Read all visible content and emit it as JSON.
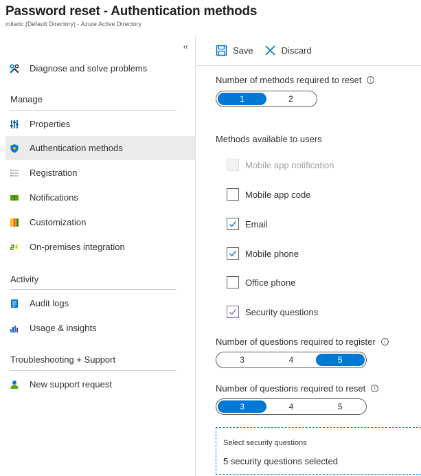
{
  "header": {
    "title": "Password reset - Authentication methods",
    "subtitle": "mitaric (Default Directory) - Azure Active Directory"
  },
  "nav": {
    "collapse_glyph": "«",
    "diagnose": {
      "label": "Diagnose and solve problems",
      "icon": "wrench-icon"
    },
    "sections": {
      "manage": "Manage",
      "activity": "Activity",
      "troubleshooting": "Troubleshooting + Support"
    },
    "manage_items": [
      {
        "label": "Properties",
        "icon": "sliders-icon"
      },
      {
        "label": "Authentication methods",
        "icon": "shield-icon",
        "active": true
      },
      {
        "label": "Registration",
        "icon": "list-icon"
      },
      {
        "label": "Notifications",
        "icon": "notification-icon"
      },
      {
        "label": "Customization",
        "icon": "customization-icon"
      },
      {
        "label": "On-premises integration",
        "icon": "integration-icon"
      }
    ],
    "activity_items": [
      {
        "label": "Audit logs",
        "icon": "audit-log-icon"
      },
      {
        "label": "Usage & insights",
        "icon": "chart-icon"
      }
    ],
    "support_items": [
      {
        "label": "New support request",
        "icon": "support-person-icon"
      }
    ]
  },
  "toolbar": {
    "save_label": "Save",
    "discard_label": "Discard"
  },
  "methods_required": {
    "label": "Number of methods required to reset",
    "options": [
      "1",
      "2"
    ],
    "selected": "1"
  },
  "methods_available": {
    "label": "Methods available to users",
    "items": [
      {
        "label": "Mobile app notification",
        "checked": false,
        "disabled": true
      },
      {
        "label": "Mobile app code",
        "checked": false,
        "disabled": false
      },
      {
        "label": "Email",
        "checked": true,
        "disabled": false
      },
      {
        "label": "Mobile phone",
        "checked": true,
        "disabled": false
      },
      {
        "label": "Office phone",
        "checked": false,
        "disabled": false
      },
      {
        "label": "Security questions",
        "checked": true,
        "disabled": false
      }
    ]
  },
  "questions_register": {
    "label": "Number of questions required to register",
    "options": [
      "3",
      "4",
      "5"
    ],
    "selected": "5"
  },
  "questions_reset": {
    "label": "Number of questions required to reset",
    "options": [
      "3",
      "4",
      "5"
    ],
    "selected": "3"
  },
  "select_questions": {
    "title": "Select security questions",
    "value": "5 security questions selected"
  },
  "colors": {
    "accent": "#0078d4",
    "check_blue": "#0078d4",
    "check_purple": "#8764b8"
  }
}
